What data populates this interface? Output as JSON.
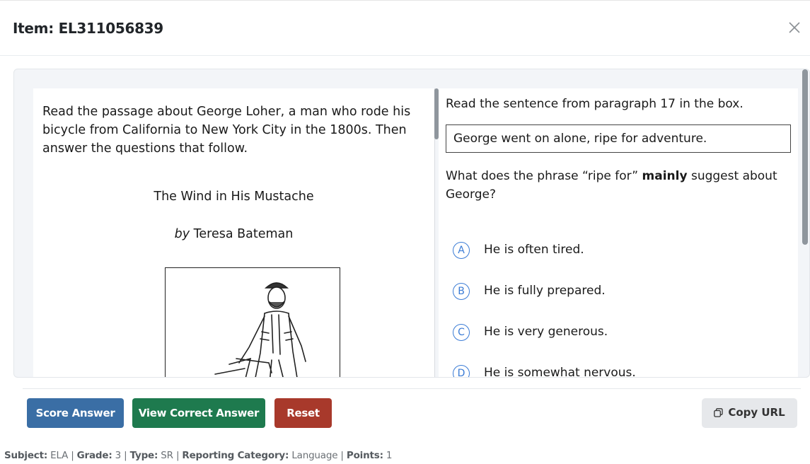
{
  "header": {
    "title": "Item: EL311056839",
    "close_icon": "close-icon"
  },
  "passage": {
    "intro": "Read the passage about George Loher, a man who rode his bicycle from California to New York City in the 1800s. Then answer the questions that follow.",
    "title": "The Wind in His Mustache",
    "author_prefix": "by",
    "author_name": "Teresa Bateman",
    "illustration": "illustration of a man with a bicycle"
  },
  "question": {
    "stem_intro": "Read the sentence from paragraph 17 in the box.",
    "boxed_sentence": "George went on alone, ripe for adventure.",
    "stem_before_bold": "What does the phrase “ripe for” ",
    "stem_bold": "mainly",
    "stem_after_bold": " suggest about George?",
    "options": [
      {
        "letter": "A",
        "text": "He is often tired."
      },
      {
        "letter": "B",
        "text": "He is fully prepared."
      },
      {
        "letter": "C",
        "text": "He is very generous."
      },
      {
        "letter": "D",
        "text": "He is somewhat nervous."
      }
    ]
  },
  "buttons": {
    "score": "Score Answer",
    "view_correct": "View Correct Answer",
    "reset": "Reset",
    "copy_url": "Copy URL",
    "copy_icon": "copy-icon"
  },
  "meta": {
    "subject_label": "Subject:",
    "subject_value": "ELA",
    "grade_label": "Grade:",
    "grade_value": "3",
    "type_label": "Type:",
    "type_value": "SR",
    "category_label": "Reporting Category:",
    "category_value": "Language",
    "points_label": "Points:",
    "points_value": "1"
  },
  "colors": {
    "score_button": "#3a6ea5",
    "view_button": "#1e7a4e",
    "reset_button": "#a8392b",
    "option_accent": "#3a7bd5"
  }
}
